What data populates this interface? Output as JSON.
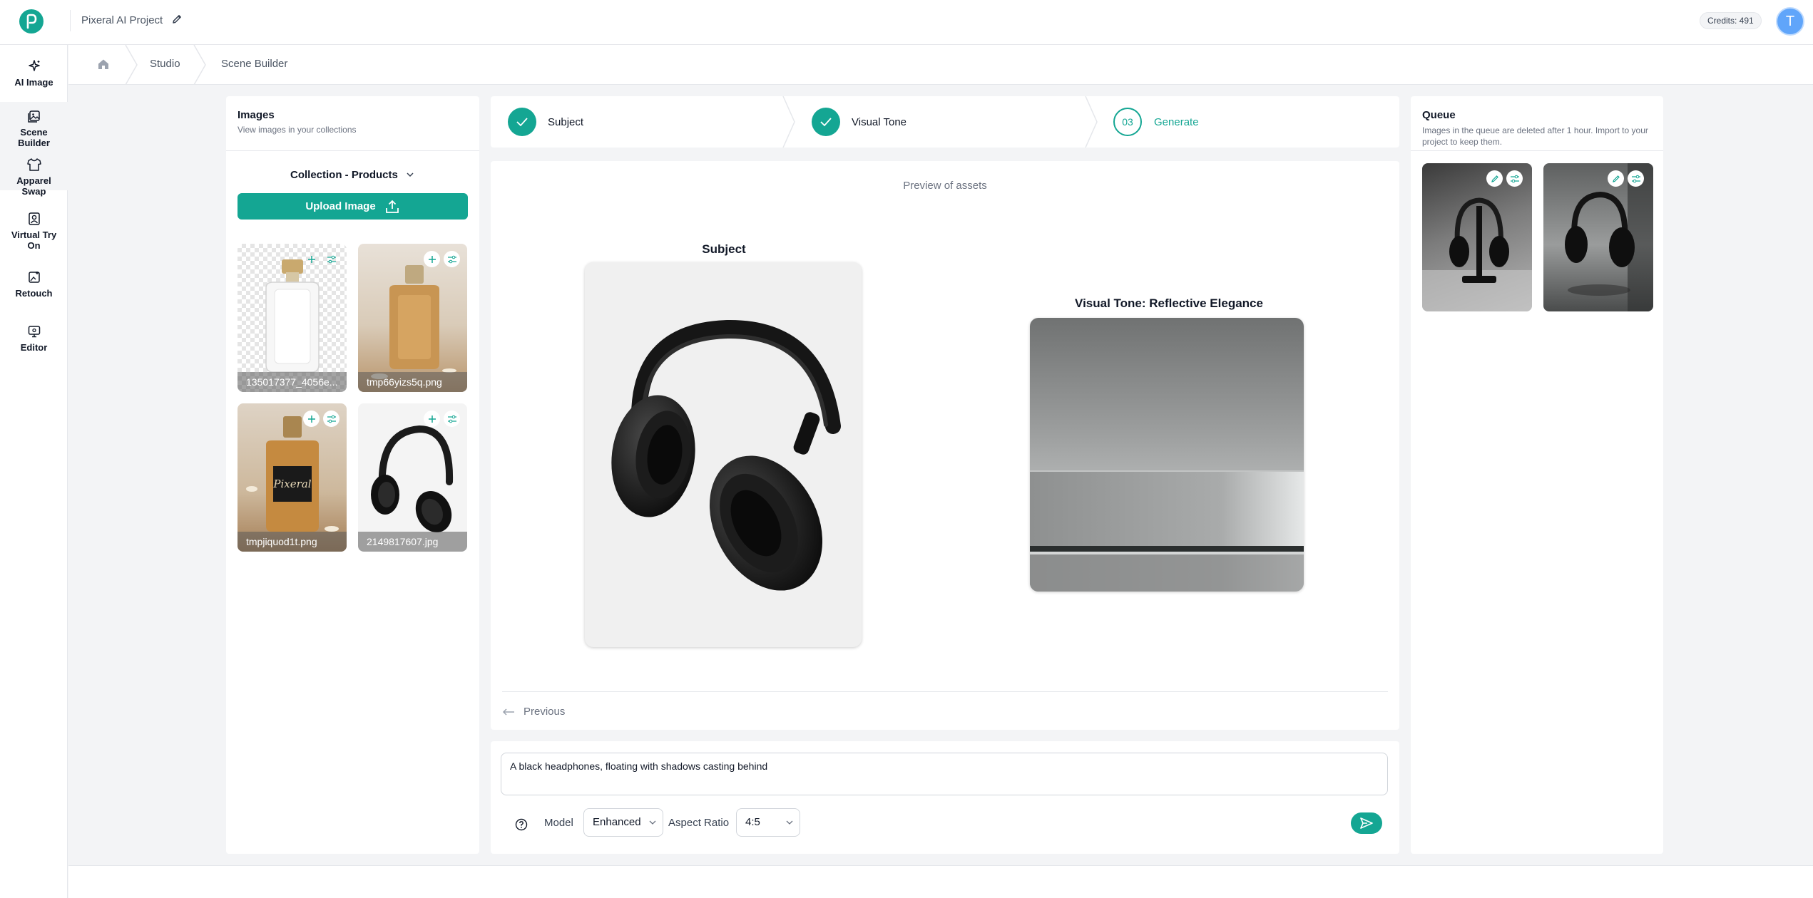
{
  "header": {
    "project_title": "Pixeral AI Project",
    "credits": "Credits: 491",
    "avatar_initial": "T"
  },
  "sidebar": {
    "items": [
      {
        "label": "AI Image",
        "icon": "sparkles-icon"
      },
      {
        "label": "Scene Builder",
        "icon": "image-icon"
      },
      {
        "label": "Apparel Swap",
        "icon": "shirt-icon"
      },
      {
        "label": "Virtual Try On",
        "icon": "person-frame-icon"
      },
      {
        "label": "Retouch",
        "icon": "image-edit-icon"
      },
      {
        "label": "Editor",
        "icon": "monitor-icon"
      }
    ]
  },
  "breadcrumb": [
    "Studio",
    "Scene Builder"
  ],
  "images_panel": {
    "title": "Images",
    "subtitle": "View images in your collections",
    "collection": "Collection - Products",
    "upload_label": "Upload Image",
    "thumbnails": [
      "135017377_4056e...",
      "tmp66yizs5q.png",
      "tmpjiquod1t.png",
      "2149817607.jpg"
    ]
  },
  "steps": [
    {
      "label": "Subject",
      "status": "done"
    },
    {
      "label": "Visual Tone",
      "status": "done"
    },
    {
      "number": "03",
      "label": "Generate",
      "status": "current"
    }
  ],
  "preview": {
    "label": "Preview of assets",
    "subject_title": "Subject",
    "tone_title": "Visual Tone: Reflective Elegance",
    "previous_label": "Previous"
  },
  "prompt": {
    "text": "A black headphones, floating with shadows casting behind",
    "model_label": "Model",
    "model_value": "Enhanced",
    "aspect_label": "Aspect Ratio",
    "aspect_value": "4:5"
  },
  "queue": {
    "title": "Queue",
    "subtitle": "Images in the queue are deleted after 1 hour. Import to your project to keep them."
  },
  "colors": {
    "accent": "#14a693"
  }
}
